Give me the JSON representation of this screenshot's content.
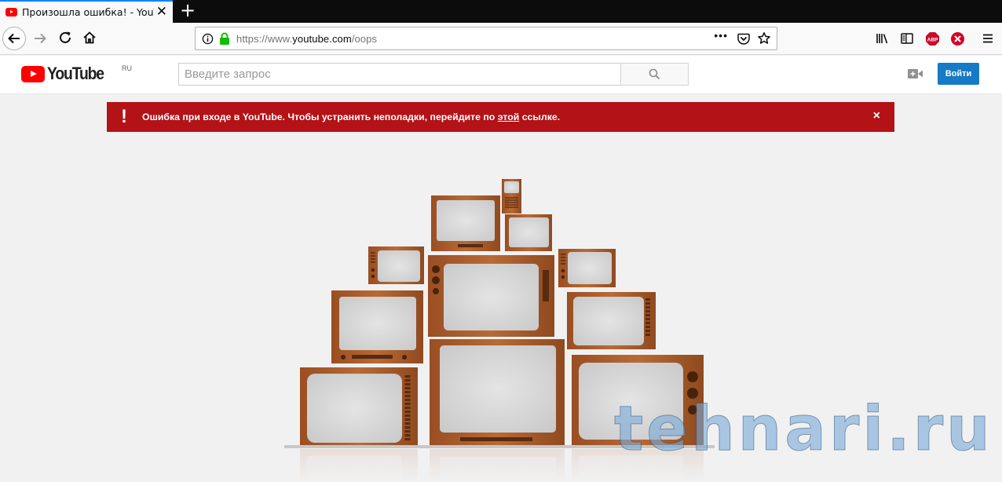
{
  "browser": {
    "tab_title": "Произошла ошибка! - YouTube",
    "tab_close": "✕",
    "new_tab": "+",
    "url_prefix": "https://www.",
    "url_domain": "youtube.com",
    "url_path": "/oops",
    "url_more": "•••",
    "abp_label": "ABP",
    "accent_color": "#0a84ff"
  },
  "youtube": {
    "logo_text": "YouTube",
    "region": "RU",
    "search_placeholder": "Введите запрос",
    "search_value": "",
    "signin_label": "Войти",
    "brand_color": "#ff0000",
    "signin_color": "#167ac6"
  },
  "alert": {
    "icon": "!",
    "text_before": "Ошибка при входе в YouTube. Чтобы устранить неполадки, перейдите по ",
    "link_text": "этой",
    "text_after": " ссылке.",
    "close": "×",
    "color": "#b31217"
  },
  "watermark": {
    "text": "tehnari.ru"
  }
}
